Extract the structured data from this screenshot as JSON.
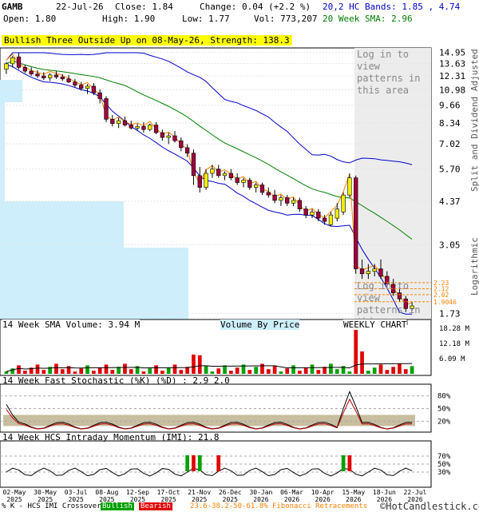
{
  "header": {
    "symbol": "GAMB",
    "date": "22-Jul-26",
    "close_label": "Close: 1.84",
    "change_label": "Change: 0.04 (+2.2 %)",
    "open_label": "Open: 1.80",
    "high_label": "High: 1.90",
    "low_label": "Low: 1.77",
    "vol_label": "Vol: 773,207",
    "hc_bands_label": "20,2 HC Bands: 1.85 , 4.74",
    "sma_label": "20 Week SMA: 2.96"
  },
  "pattern_banner": "Bullish Three Outside Up on 08-May-26, Strength: 138.3",
  "login_notice": "Log in to view patterns in this area",
  "panel_labels": {
    "volume_sma": "14 Week SMA Volume: 3.94 M",
    "volume_by_price": "Volume By Price",
    "weekly_chart": "WEEKLY CHART",
    "stochastic": "14 Week Fast Stochastic (%K) (%D) : 2.9   2.0",
    "momentum": "14 Week HCS Intraday Momentum (IMI): 21.8"
  },
  "side_labels": {
    "split": "Split and Dividend Adjusted",
    "log": "Logarithmic"
  },
  "footer": {
    "legend_prefix": "% K - HCS IMI Crossover:",
    "bullish": "Bullish",
    "bearish": "Bearish",
    "fib": "23.6-38.2-50-61.8% Fibonacci Retracements",
    "copyright": "©HotCandlestick.com"
  },
  "colors": {
    "up": "#f0f000",
    "down": "#a0003c",
    "sma": "#008000",
    "bands": "#0000cc",
    "trend": "#ff8000",
    "vbp": "#cdeefa",
    "bullish": "#00a000",
    "bearish": "#e00000",
    "stoch_fill": "#c8bea0"
  },
  "chart_data": {
    "type": "candlestick",
    "scale": "log",
    "price_ticks": [
      "14.95",
      "13.63",
      "12.31",
      "10.98",
      "9.66",
      "8.34",
      "7.02",
      "5.70",
      "4.37",
      "3.05",
      "1.73"
    ],
    "fib_levels": [
      "2.23",
      "2.12",
      "2.02",
      "1.9046"
    ],
    "x_ticks": [
      "02-May 2025",
      "30-May 2025",
      "03-Jul 2025",
      "08-Aug 2025",
      "12-Sep 2025",
      "17-Oct 2025",
      "21-Nov 2025",
      "26-Dec 2025",
      "30-Jan 2026",
      "06-Mar 2026",
      "10-Apr 2026",
      "15-May 2026",
      "18-Jun 2026",
      "22-Jul 2026"
    ],
    "candles": [
      {
        "o": 13.0,
        "h": 13.8,
        "l": 12.5,
        "c": 13.6
      },
      {
        "o": 13.6,
        "h": 14.5,
        "l": 13.2,
        "c": 14.3
      },
      {
        "o": 14.4,
        "h": 14.9,
        "l": 13.0,
        "c": 13.2
      },
      {
        "o": 13.2,
        "h": 13.5,
        "l": 12.6,
        "c": 12.8
      },
      {
        "o": 12.8,
        "h": 13.2,
        "l": 12.3,
        "c": 12.5
      },
      {
        "o": 12.5,
        "h": 12.9,
        "l": 12.1,
        "c": 12.3
      },
      {
        "o": 12.3,
        "h": 12.7,
        "l": 11.9,
        "c": 12.1
      },
      {
        "o": 12.1,
        "h": 12.6,
        "l": 11.8,
        "c": 12.4
      },
      {
        "o": 12.4,
        "h": 12.8,
        "l": 12.0,
        "c": 12.2
      },
      {
        "o": 12.2,
        "h": 12.5,
        "l": 11.8,
        "c": 12.0
      },
      {
        "o": 12.0,
        "h": 12.4,
        "l": 11.6,
        "c": 11.7
      },
      {
        "o": 11.7,
        "h": 12.0,
        "l": 11.2,
        "c": 11.4
      },
      {
        "o": 11.4,
        "h": 11.7,
        "l": 10.9,
        "c": 11.1
      },
      {
        "o": 11.1,
        "h": 11.5,
        "l": 10.6,
        "c": 11.3
      },
      {
        "o": 11.3,
        "h": 11.6,
        "l": 10.5,
        "c": 10.7
      },
      {
        "o": 10.7,
        "h": 11.0,
        "l": 9.8,
        "c": 10.2
      },
      {
        "o": 10.2,
        "h": 10.4,
        "l": 8.4,
        "c": 8.6
      },
      {
        "o": 8.6,
        "h": 8.9,
        "l": 8.1,
        "c": 8.3
      },
      {
        "o": 8.3,
        "h": 8.7,
        "l": 8.0,
        "c": 8.5
      },
      {
        "o": 8.5,
        "h": 8.8,
        "l": 8.1,
        "c": 8.2
      },
      {
        "o": 8.2,
        "h": 8.5,
        "l": 7.9,
        "c": 8.0
      },
      {
        "o": 8.0,
        "h": 8.3,
        "l": 7.8,
        "c": 8.1
      },
      {
        "o": 8.1,
        "h": 8.4,
        "l": 7.7,
        "c": 7.9
      },
      {
        "o": 7.9,
        "h": 8.3,
        "l": 7.8,
        "c": 8.2
      },
      {
        "o": 8.2,
        "h": 8.4,
        "l": 7.6,
        "c": 7.7
      },
      {
        "o": 7.7,
        "h": 7.9,
        "l": 7.2,
        "c": 7.4
      },
      {
        "o": 7.4,
        "h": 7.7,
        "l": 7.0,
        "c": 7.5
      },
      {
        "o": 7.5,
        "h": 7.8,
        "l": 7.1,
        "c": 7.2
      },
      {
        "o": 7.2,
        "h": 7.4,
        "l": 6.6,
        "c": 6.8
      },
      {
        "o": 6.8,
        "h": 7.0,
        "l": 6.3,
        "c": 6.5
      },
      {
        "o": 6.5,
        "h": 6.7,
        "l": 5.0,
        "c": 5.4
      },
      {
        "o": 5.4,
        "h": 5.8,
        "l": 4.7,
        "c": 4.9
      },
      {
        "o": 4.9,
        "h": 5.7,
        "l": 4.8,
        "c": 5.5
      },
      {
        "o": 5.5,
        "h": 5.9,
        "l": 5.3,
        "c": 5.7
      },
      {
        "o": 5.7,
        "h": 5.9,
        "l": 5.3,
        "c": 5.4
      },
      {
        "o": 5.4,
        "h": 5.6,
        "l": 5.2,
        "c": 5.5
      },
      {
        "o": 5.5,
        "h": 5.7,
        "l": 5.2,
        "c": 5.3
      },
      {
        "o": 5.3,
        "h": 5.5,
        "l": 5.0,
        "c": 5.1
      },
      {
        "o": 5.1,
        "h": 5.3,
        "l": 4.9,
        "c": 5.2
      },
      {
        "o": 5.2,
        "h": 5.3,
        "l": 4.8,
        "c": 4.9
      },
      {
        "o": 4.9,
        "h": 5.1,
        "l": 4.7,
        "c": 5.0
      },
      {
        "o": 5.0,
        "h": 5.1,
        "l": 4.6,
        "c": 4.7
      },
      {
        "o": 4.7,
        "h": 4.9,
        "l": 4.5,
        "c": 4.6
      },
      {
        "o": 4.6,
        "h": 4.8,
        "l": 4.3,
        "c": 4.4
      },
      {
        "o": 4.4,
        "h": 4.6,
        "l": 4.2,
        "c": 4.5
      },
      {
        "o": 4.5,
        "h": 4.6,
        "l": 4.2,
        "c": 4.3
      },
      {
        "o": 4.3,
        "h": 4.5,
        "l": 4.2,
        "c": 4.4
      },
      {
        "o": 4.4,
        "h": 4.5,
        "l": 4.0,
        "c": 4.1
      },
      {
        "o": 4.1,
        "h": 4.2,
        "l": 3.8,
        "c": 3.9
      },
      {
        "o": 3.9,
        "h": 4.1,
        "l": 3.8,
        "c": 4.0
      },
      {
        "o": 4.0,
        "h": 4.1,
        "l": 3.7,
        "c": 3.8
      },
      {
        "o": 3.8,
        "h": 3.9,
        "l": 3.6,
        "c": 3.7
      },
      {
        "o": 3.6,
        "h": 4.0,
        "l": 3.55,
        "c": 3.9
      },
      {
        "o": 3.8,
        "h": 4.3,
        "l": 3.7,
        "c": 4.1
      },
      {
        "o": 4.0,
        "h": 4.7,
        "l": 3.9,
        "c": 4.6
      },
      {
        "o": 4.6,
        "h": 5.5,
        "l": 4.5,
        "c": 5.3
      },
      {
        "o": 5.3,
        "h": 5.4,
        "l": 2.4,
        "c": 2.5
      },
      {
        "o": 2.5,
        "h": 2.7,
        "l": 2.3,
        "c": 2.4
      },
      {
        "o": 2.4,
        "h": 2.6,
        "l": 2.3,
        "c": 2.45
      },
      {
        "o": 2.45,
        "h": 2.6,
        "l": 2.35,
        "c": 2.5
      },
      {
        "o": 2.5,
        "h": 2.7,
        "l": 2.3,
        "c": 2.35
      },
      {
        "o": 2.35,
        "h": 2.45,
        "l": 2.15,
        "c": 2.2
      },
      {
        "o": 2.2,
        "h": 2.3,
        "l": 2.0,
        "c": 2.05
      },
      {
        "o": 2.05,
        "h": 2.15,
        "l": 1.9,
        "c": 1.95
      },
      {
        "o": 1.95,
        "h": 2.0,
        "l": 1.75,
        "c": 1.8
      },
      {
        "o": 1.8,
        "h": 1.9,
        "l": 1.77,
        "c": 1.84
      }
    ],
    "volume_ticks": [
      "18.28 M",
      "12.18 M",
      "6.09 M"
    ],
    "stochastic_ticks": [
      "80%",
      "50%",
      "20%"
    ],
    "momentum_ticks": [
      "70%",
      "50%",
      "30%"
    ]
  }
}
